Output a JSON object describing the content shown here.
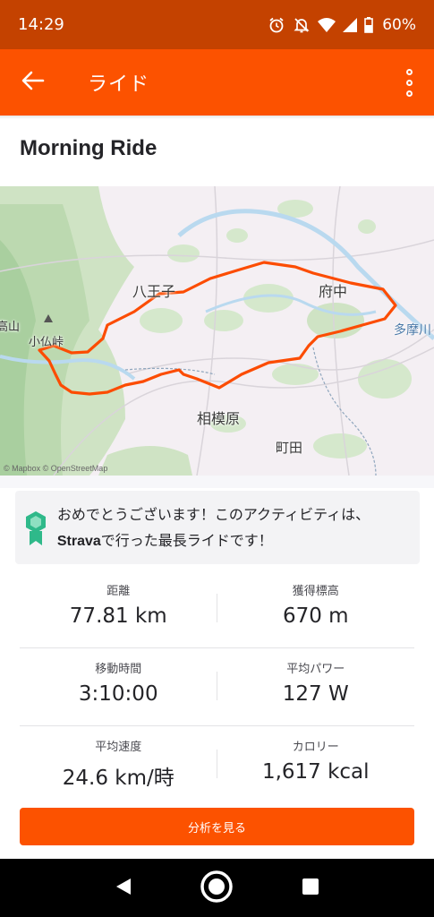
{
  "status_bar": {
    "time": "14:29",
    "battery": "60%",
    "icons": [
      "alarm-icon",
      "bell-off-icon",
      "wifi-icon",
      "signal-icon",
      "battery-icon"
    ]
  },
  "app_bar": {
    "title": "ライド",
    "back_icon": "arrow-left-icon",
    "menu_icon": "more-vertical-icon"
  },
  "activity": {
    "title": "Morning Ride"
  },
  "map": {
    "labels": {
      "hachioji": "八王子",
      "fuchu": "府中",
      "tamagawa": "多摩川",
      "kobotoke": "小仏峠",
      "sagamihara": "相模原",
      "machida": "町田",
      "takao": "高山"
    },
    "credit": "© Mapbox © OpenStreetMap",
    "route_color": "#fc4c02"
  },
  "achievement": {
    "text_before": "おめでとうございます！このアクティビティは、",
    "brand": "Strava",
    "text_after": "で行った最長ライドです！",
    "icon": "medal-icon"
  },
  "stats": [
    {
      "label": "距離",
      "value": "77.81 km"
    },
    {
      "label": "獲得標高",
      "value": "670 m"
    },
    {
      "label": "移動時間",
      "value": "3:10:00"
    },
    {
      "label": "平均パワー",
      "value": "127 W"
    },
    {
      "label": "平均速度",
      "value": "24.6 km/時"
    },
    {
      "label": "カロリー",
      "value": "1,617 kcal"
    }
  ],
  "analyze_button": "分析を見る",
  "colors": {
    "brand": "#fc5200",
    "status_bar": "#c44200"
  }
}
